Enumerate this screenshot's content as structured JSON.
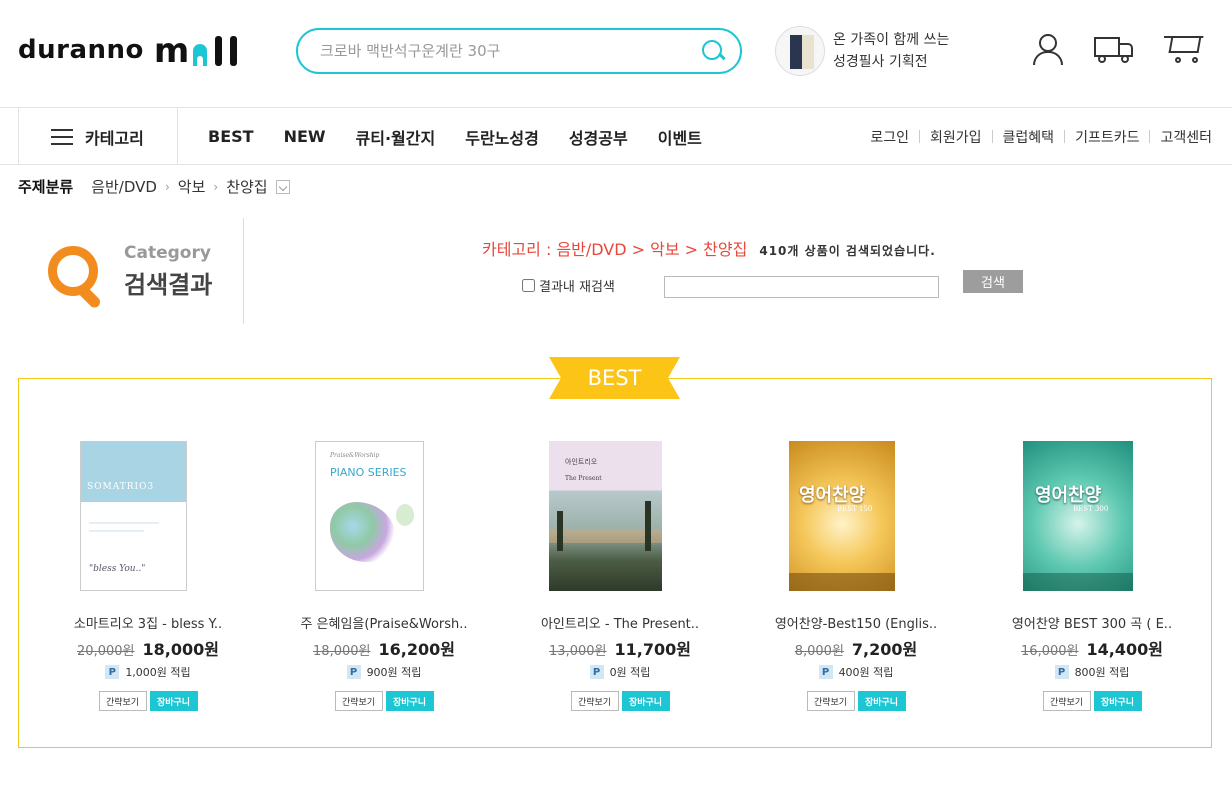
{
  "header": {
    "logo_text": "duranno",
    "logo_mall": "m",
    "search_placeholder": "크로바 맥반석구운계란 30구",
    "promo_line1": "온 가족이 함께 쓰는",
    "promo_line2": "성경필사 기획전"
  },
  "nav": {
    "category_label": "카테고리",
    "menu": [
      "BEST",
      "NEW",
      "큐티·월간지",
      "두란노성경",
      "성경공부",
      "이벤트"
    ],
    "util": [
      "로그인",
      "회원가입",
      "클럽혜택",
      "기프트카드",
      "고객센터"
    ]
  },
  "breadcrumb": {
    "lead": "주제분류",
    "items": [
      "음반/DVD",
      "악보",
      "찬양집"
    ]
  },
  "result": {
    "title_en": "Category",
    "title_ko": "검색결과",
    "path": "카테고리 : 음반/DVD > 악보 > 찬양집",
    "count": "410개 상품이 검색되었습니다.",
    "research_label": "결과내 재검색",
    "search_button": "검색"
  },
  "best": {
    "tag": "BEST",
    "quick_label": "간략보기",
    "cart_label": "장바구니",
    "products": [
      {
        "name": "소마트리오 3집 - bless Y..",
        "orig": "20,000원",
        "sale": "18,000원",
        "points": "1,000원 적립",
        "cover_title": "SOMATRIO3",
        "cover_sub": "\"bless You..\""
      },
      {
        "name": "주 은혜임을(Praise&Worsh..",
        "orig": "18,000원",
        "sale": "16,200원",
        "points": "900원 적립",
        "cover_title": "PIANO SERIES",
        "cover_sub": "Praise&Worship"
      },
      {
        "name": "아인트리오 - The Present..",
        "orig": "13,000원",
        "sale": "11,700원",
        "points": "0원 적립",
        "cover_title": "아인트리오",
        "cover_sub": "The Present"
      },
      {
        "name": "영어찬양-Best150 (Englis..",
        "orig": "8,000원",
        "sale": "7,200원",
        "points": "400원 적립",
        "cover_title": "영어찬양",
        "cover_sub": "BEST 150"
      },
      {
        "name": "영어찬양 BEST 300 곡 ( E..",
        "orig": "16,000원",
        "sale": "14,400원",
        "points": "800원 적립",
        "cover_title": "영어찬양",
        "cover_sub": "BEST 300"
      }
    ]
  }
}
